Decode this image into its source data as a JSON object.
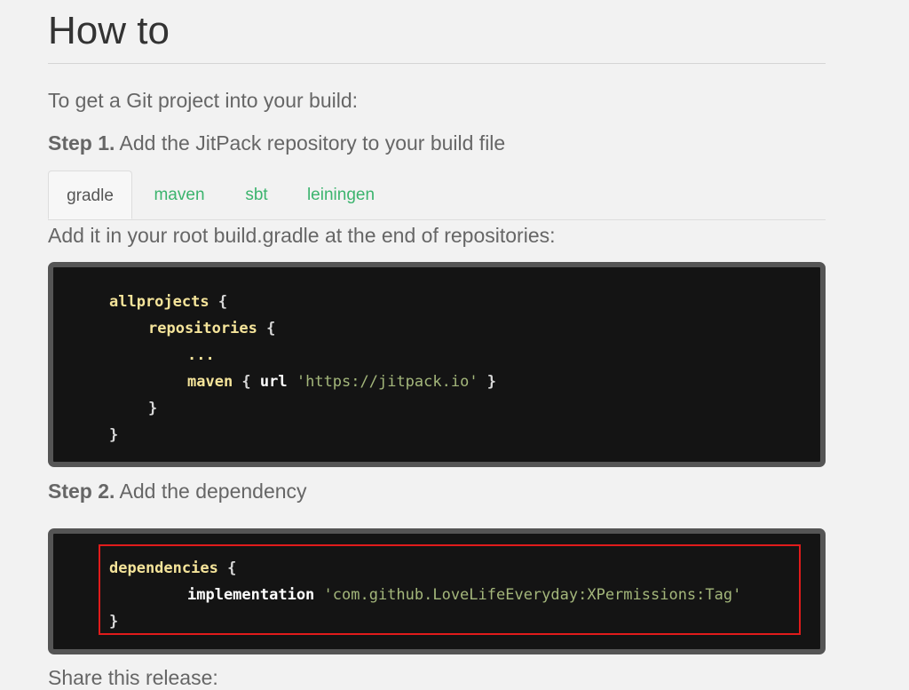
{
  "title": "How to",
  "intro": "To get a Git project into your build:",
  "step1": {
    "label": "Step 1.",
    "text": " Add the JitPack repository to your build file"
  },
  "tabs": [
    {
      "label": "gradle",
      "active": true
    },
    {
      "label": "maven",
      "active": false
    },
    {
      "label": "sbt",
      "active": false
    },
    {
      "label": "leiningen",
      "active": false
    }
  ],
  "hint": "Add it in your root build.gradle at the end of repositories:",
  "code1": {
    "l1_kw": "allprojects",
    "l1_br": " {",
    "l2_kw": "repositories",
    "l2_br": " {",
    "l3_kw": "...",
    "l4_kw": "maven",
    "l4_br1": " { ",
    "l4_plain": "url",
    "l4_str": " 'https://jitpack.io'",
    "l4_br2": " }",
    "l5_br": "}",
    "l6_br": "}"
  },
  "step2": {
    "label": "Step 2.",
    "text": " Add the dependency"
  },
  "code2": {
    "l1_kw": "dependencies",
    "l1_br": " {",
    "l2_plain": "implementation",
    "l2_str": " 'com.github.LoveLifeEveryday:XPermissions:Tag'",
    "l3_br": "}"
  },
  "share": "Share this release:",
  "colors": {
    "accent": "#3cb46e",
    "highlight": "#e01b1b",
    "code_bg": "#141414",
    "keyword": "#f5e49a",
    "string": "#a4b77b"
  }
}
